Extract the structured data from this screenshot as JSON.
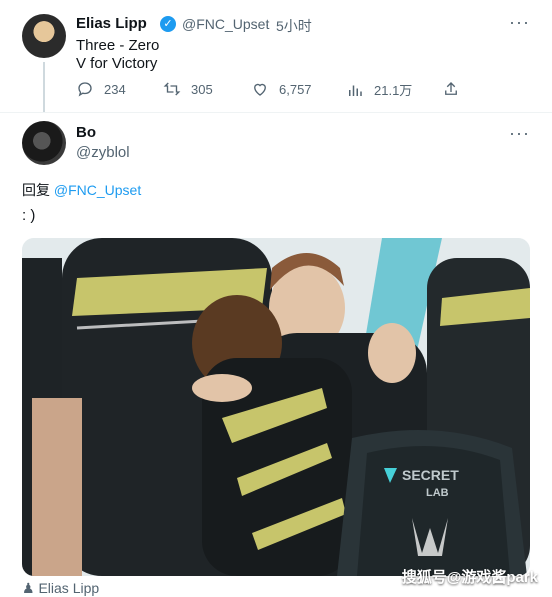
{
  "tweet1": {
    "name": "Elias Lipp",
    "handle": "@FNC_Upset",
    "separator": "·",
    "time": "5小时",
    "line1": "Three - Zero",
    "line2": "V for Victory",
    "actions": {
      "replies": "234",
      "retweets": "305",
      "likes": "6,757",
      "views": "21.1万"
    },
    "more_icon": "ellipsis-icon",
    "verified_icon": "verified-badge-icon"
  },
  "tweet2": {
    "name": "Bo",
    "handle": "@zyblol",
    "reply_prefix": "回复",
    "reply_to": "@FNC_Upset",
    "text": ": )",
    "photo_chair_text": "SECRET LAB",
    "caption": "Elias Lipp",
    "caption_icon": "person-icon"
  },
  "watermark": "搜狐号@游戏酱park",
  "colors": {
    "accent": "#1d9bf0",
    "muted": "#536471",
    "jersey_stripe": "#c7c56b"
  }
}
